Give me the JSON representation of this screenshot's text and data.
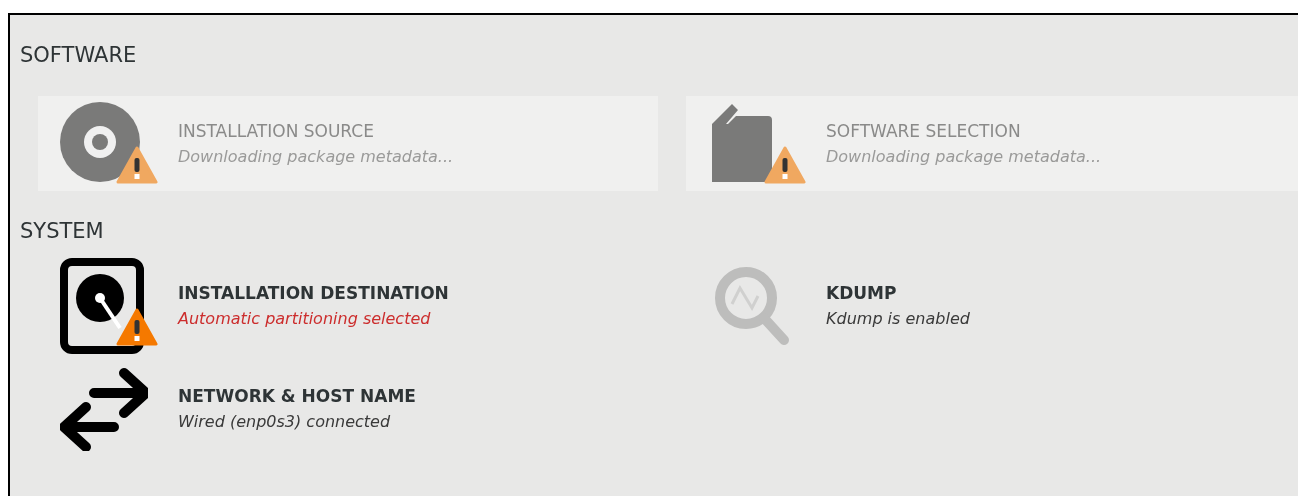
{
  "sections": [
    {
      "title": "SOFTWARE",
      "items": [
        {
          "kind": "disc",
          "title": "INSTALLATION SOURCE",
          "status": "Downloading package metadata...",
          "disabled": true,
          "warning": true,
          "error": false
        },
        {
          "kind": "package",
          "title": "SOFTWARE SELECTION",
          "status": "Downloading package metadata...",
          "disabled": true,
          "warning": true,
          "error": false
        }
      ]
    },
    {
      "title": "SYSTEM",
      "items": [
        {
          "kind": "disk",
          "title": "INSTALLATION DESTINATION",
          "status": "Automatic partitioning selected",
          "disabled": false,
          "warning": true,
          "error": true
        },
        {
          "kind": "kdump",
          "title": "KDUMP",
          "status": "Kdump is enabled",
          "disabled": false,
          "warning": false,
          "error": false
        },
        {
          "kind": "network",
          "title": "NETWORK & HOST NAME",
          "status": "Wired (enp0s3) connected",
          "disabled": false,
          "warning": false,
          "error": false
        }
      ]
    }
  ]
}
